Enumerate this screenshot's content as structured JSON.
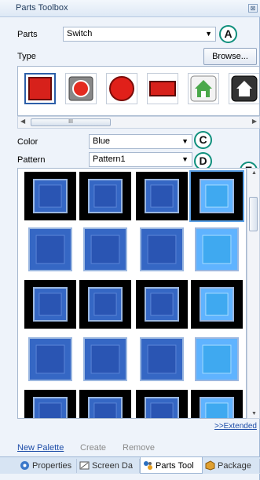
{
  "window": {
    "title": "Parts Toolbox",
    "pin_glyph": "⊠"
  },
  "parts": {
    "label": "Parts",
    "value": "Switch"
  },
  "type": {
    "label": "Type",
    "browse_label": "Browse..."
  },
  "type_tiles": [
    "red-square-icon",
    "red-round-button-icon",
    "red-circle-icon",
    "red-rectangle-icon",
    "house-icon",
    "house-dark-icon"
  ],
  "color": {
    "label": "Color",
    "value": "Blue"
  },
  "pattern": {
    "label": "Pattern",
    "value": "Pattern1"
  },
  "callouts": {
    "a": "A",
    "c": "C",
    "d": "D",
    "e": "E"
  },
  "hscroll_thumb": "III",
  "extended_link": ">>Extended",
  "footer": {
    "new_palette": "New Palette",
    "create": "Create",
    "remove": "Remove"
  },
  "tabs": [
    {
      "label": "Properties",
      "icon": "properties-icon"
    },
    {
      "label": "Screen Da",
      "icon": "screen-data-icon"
    },
    {
      "label": "Parts Tool",
      "icon": "parts-tool-icon"
    },
    {
      "label": "Package",
      "icon": "package-icon"
    }
  ],
  "colors": {
    "accent_blue": "#3a7bd5",
    "callout_border": "#0f8f7c",
    "link": "#1f4ea8"
  }
}
